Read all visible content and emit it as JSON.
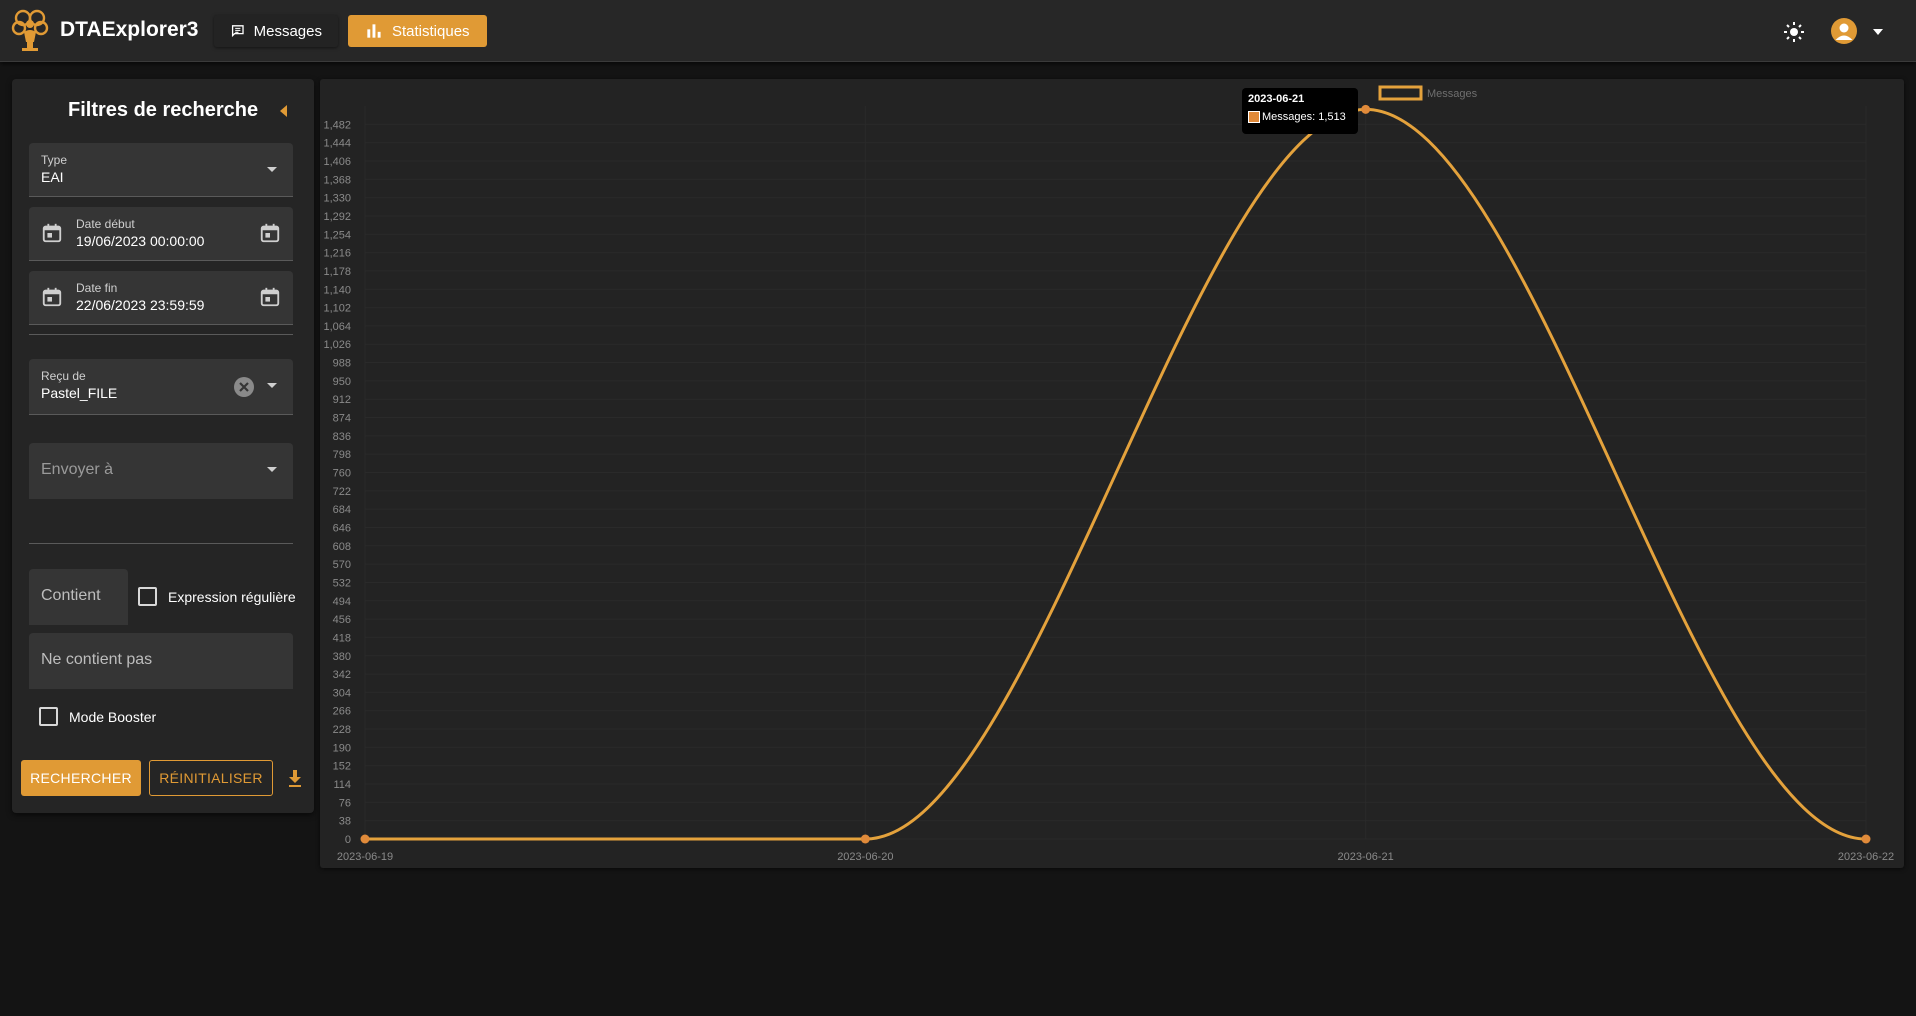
{
  "app": {
    "title": "DTAExplorer3"
  },
  "nav": {
    "messages_label": "Messages",
    "statistics_label": "Statistiques"
  },
  "icons": {
    "logo": "tree-person-logo-icon",
    "messages": "chat-message-icon",
    "statistics": "bar-chart-icon",
    "theme": "sun-icon",
    "account": "account-circle-icon",
    "account_menu": "caret-down-icon",
    "collapse": "caret-left-icon",
    "calendar": "calendar-icon",
    "clear": "clear-circle-icon",
    "download": "download-icon"
  },
  "colors": {
    "accent": "#e09a35",
    "background": "#141414",
    "panel": "#252525",
    "series": "#e4a23c",
    "point": "#e08a3a"
  },
  "filters": {
    "title": "Filtres de recherche",
    "type": {
      "label": "Type",
      "value": "EAI"
    },
    "date_start": {
      "label": "Date début",
      "value": "19/06/2023 00:00:00"
    },
    "date_end": {
      "label": "Date fin",
      "value": "22/06/2023 23:59:59"
    },
    "received_from": {
      "label": "Reçu de",
      "value": "Pastel_FILE"
    },
    "send_to": {
      "placeholder": "Envoyer à"
    },
    "contains": {
      "placeholder": "Contient"
    },
    "regex": {
      "label": "Expression régulière",
      "checked": false
    },
    "not_contains": {
      "placeholder": "Ne contient pas"
    },
    "booster": {
      "label": "Mode Booster",
      "checked": false
    },
    "search_label": "Rechercher",
    "reset_label": "Réinitialiser"
  },
  "chart_data": {
    "type": "line",
    "x": [
      "2023-06-19",
      "2023-06-20",
      "2023-06-21",
      "2023-06-22"
    ],
    "series": [
      {
        "name": "Messages",
        "values": [
          0,
          0,
          1513,
          0
        ]
      }
    ],
    "y_ticks": [
      0,
      38,
      76,
      114,
      152,
      190,
      228,
      266,
      304,
      342,
      380,
      418,
      456,
      494,
      532,
      570,
      608,
      646,
      684,
      722,
      760,
      798,
      836,
      874,
      912,
      950,
      988,
      1026,
      1064,
      1102,
      1140,
      1178,
      1216,
      1254,
      1292,
      1330,
      1368,
      1406,
      1444,
      1482
    ],
    "ylim": [
      0,
      1520
    ],
    "legend": "top-center",
    "grid": true,
    "tooltip": {
      "title": "2023-06-21",
      "text": "Messages: 1,513"
    }
  }
}
